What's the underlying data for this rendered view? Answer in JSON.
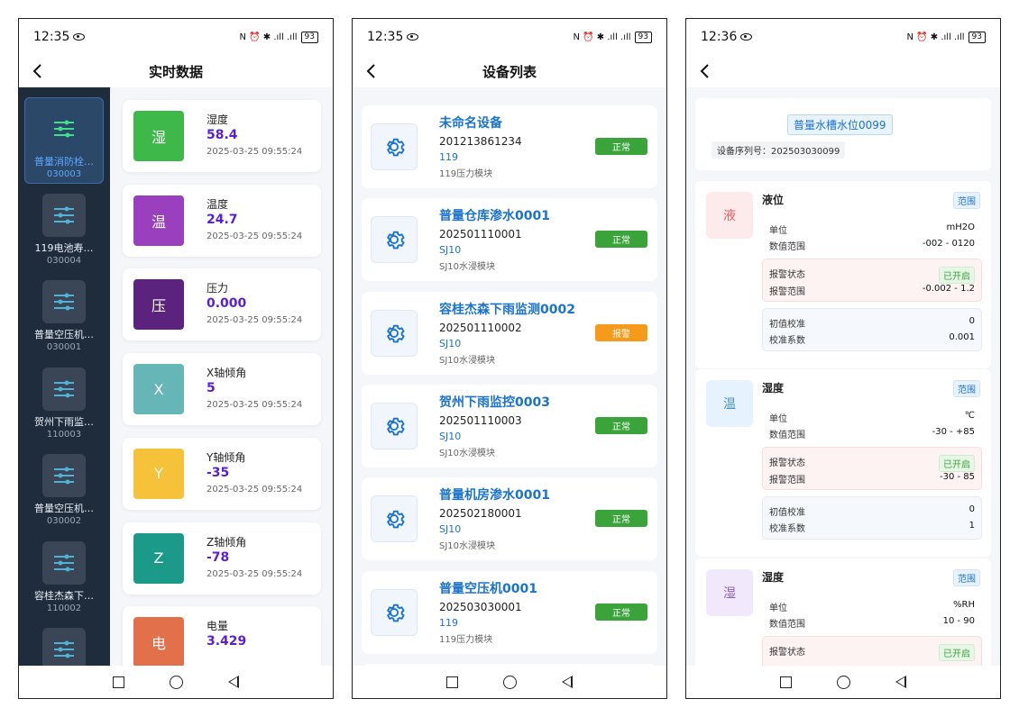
{
  "status_bar": [
    {
      "time": "12:35",
      "battery": "93",
      "icons": "N ⏰ ✱ .ıll .ıll"
    },
    {
      "time": "12:35",
      "battery": "93",
      "icons": "N ⏰ ✱ .ıll .ıll"
    },
    {
      "time": "12:36",
      "battery": "93",
      "icons": "N ⏰ ✱ .ıll .ıll"
    }
  ],
  "screen1": {
    "title": "实时数据",
    "sidebar": [
      {
        "name": "普量消防栓…",
        "code": "030003",
        "active": true
      },
      {
        "name": "119电池寿…",
        "code": "030004",
        "active": false
      },
      {
        "name": "普量空压机…",
        "code": "030001",
        "active": false
      },
      {
        "name": "贺州下雨监…",
        "code": "110003",
        "active": false
      },
      {
        "name": "普量空压机…",
        "code": "030002",
        "active": false
      },
      {
        "name": "容桂杰森下…",
        "code": "110002",
        "active": false
      },
      {
        "name": "",
        "code": "",
        "active": false
      }
    ],
    "readings": [
      {
        "badge": "湿",
        "color": "#3fb84a",
        "label": "湿度",
        "value": "58.4",
        "time": "2025-03-25 09:55:24"
      },
      {
        "badge": "温",
        "color": "#9a3fbe",
        "label": "温度",
        "value": "24.7",
        "time": "2025-03-25 09:55:24"
      },
      {
        "badge": "压",
        "color": "#5b237d",
        "label": "压力",
        "value": "0.000",
        "time": "2025-03-25 09:55:24"
      },
      {
        "badge": "X",
        "color": "#66b6b8",
        "label": "X轴倾角",
        "value": "5",
        "time": "2025-03-25 09:55:24"
      },
      {
        "badge": "Y",
        "color": "#f6c23a",
        "label": "Y轴倾角",
        "value": "-35",
        "time": "2025-03-25 09:55:24"
      },
      {
        "badge": "Z",
        "color": "#1b9a8a",
        "label": "Z轴倾角",
        "value": "-78",
        "time": "2025-03-25 09:55:24"
      },
      {
        "badge": "电",
        "color": "#e2704a",
        "label": "电量",
        "value": "3.429",
        "time": ""
      }
    ]
  },
  "screen2": {
    "title": "设备列表",
    "devices": [
      {
        "name": "未命名设备",
        "sn": "201213861234",
        "model": "119",
        "module": "119压力模块",
        "status": "正常",
        "status_color": "#3aa43a"
      },
      {
        "name": "普量仓库渗水0001",
        "sn": "202501110001",
        "model": "SJ10",
        "module": "SJ10水浸模块",
        "status": "正常",
        "status_color": "#3aa43a"
      },
      {
        "name": "容桂杰森下雨监测0002",
        "sn": "202501110002",
        "model": "SJ10",
        "module": "SJ10水浸模块",
        "status": "报警",
        "status_color": "#f59a1a"
      },
      {
        "name": "贺州下雨监控0003",
        "sn": "202501110003",
        "model": "SJ10",
        "module": "SJ10水浸模块",
        "status": "正常",
        "status_color": "#3aa43a"
      },
      {
        "name": "普量机房渗水0001",
        "sn": "202502180001",
        "model": "SJ10",
        "module": "SJ10水浸模块",
        "status": "正常",
        "status_color": "#3aa43a"
      },
      {
        "name": "普量空压机0001",
        "sn": "202503030001",
        "model": "119",
        "module": "119压力模块",
        "status": "正常",
        "status_color": "#3aa43a"
      }
    ]
  },
  "screen3": {
    "device_name": "普量水槽水位0099",
    "serial": "设备序列号：202503030099",
    "sections": [
      {
        "badge": "液",
        "badge_color": "#e06060",
        "badge_bg": "#fdeaea",
        "title": "液位",
        "range_tag": "范围",
        "unit_label": "单位",
        "unit": "mH2O",
        "range_label": "数值范围",
        "range": "-002 - 0120",
        "alarm_label": "报警状态",
        "alarm": "已开启",
        "alarm_range_label": "报警范围",
        "alarm_range": "-0.002 - 1.2",
        "init_label": "初值校准",
        "init": "0",
        "coef_label": "校准系数",
        "coef": "0.001"
      },
      {
        "badge": "温",
        "badge_color": "#4a90d9",
        "badge_bg": "#e6f2fd",
        "title": "湿度",
        "range_tag": "范围",
        "unit_label": "单位",
        "unit": "℃",
        "range_label": "数值范围",
        "range": "-30 - +85",
        "alarm_label": "报警状态",
        "alarm": "已开启",
        "alarm_range_label": "报警范围",
        "alarm_range": "-30 - 85",
        "init_label": "初值校准",
        "init": "0",
        "coef_label": "校准系数",
        "coef": "1"
      },
      {
        "badge": "湿",
        "badge_color": "#8a5cc8",
        "badge_bg": "#f1e8fb",
        "title": "湿度",
        "range_tag": "范围",
        "unit_label": "单位",
        "unit": "%RH",
        "range_label": "数值范围",
        "range": "10 - 90",
        "alarm_label": "报警状态",
        "alarm": "已开启",
        "alarm_range_label": "",
        "alarm_range": "",
        "init_label": "",
        "init": "",
        "coef_label": "",
        "coef": ""
      }
    ]
  }
}
